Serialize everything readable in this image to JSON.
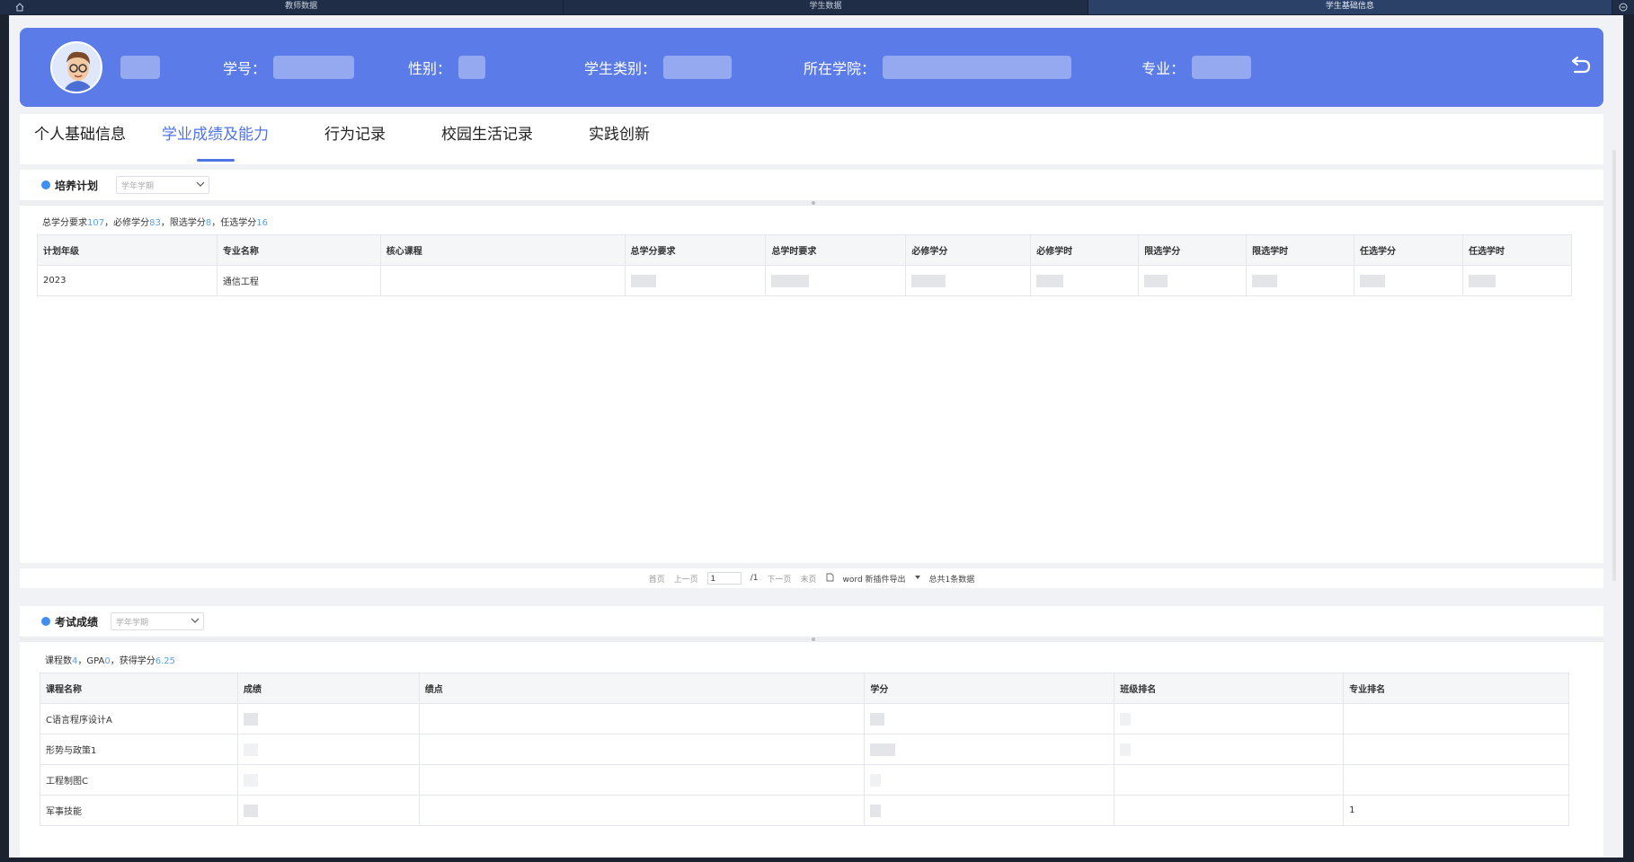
{
  "topbar": {
    "tabs": [
      "教师数据",
      "学生数据",
      "学生基础信息"
    ]
  },
  "profile": {
    "labels": {
      "student_no": "学号：",
      "gender": "性别：",
      "category": "学生类别：",
      "college": "所在学院：",
      "major": "专业："
    }
  },
  "nav": {
    "tabs": [
      "个人基础信息",
      "学业成绩及能力",
      "行为记录",
      "校园生活记录",
      "实践创新"
    ],
    "active_index": 1
  },
  "plan": {
    "title": "培养计划",
    "select_placeholder": "学年学期",
    "summary": {
      "total_label": "总学分要求",
      "total": "107",
      "req_label": "，必修学分",
      "req": "83",
      "lim_label": "，限选学分",
      "lim": "8",
      "opt_label": "，任选学分",
      "opt": "16"
    },
    "columns": [
      "计划年级",
      "专业名称",
      "核心课程",
      "总学分要求",
      "总学时要求",
      "必修学分",
      "必修学时",
      "限选学分",
      "限选学时",
      "任选学分",
      "任选学时"
    ],
    "rows": [
      {
        "year": "2023",
        "major": "通信工程"
      }
    ]
  },
  "pager": {
    "first": "首页",
    "prev": "上一页",
    "page": "1",
    "of": "/1",
    "next": "下一页",
    "last": "末页",
    "export": "word 新插件导出",
    "total": "总共1条数据"
  },
  "exam": {
    "title": "考试成绩",
    "select_placeholder": "学年学期",
    "summary": {
      "courses_label": "课程数",
      "courses": "4",
      "gpa_label": "，GPA",
      "gpa": "0",
      "credits_label": "，获得学分",
      "credits": "6.25"
    },
    "columns": [
      "课程名称",
      "成绩",
      "绩点",
      "学分",
      "班级排名",
      "专业排名"
    ],
    "rows": [
      {
        "course": "C语言程序设计A",
        "major_rank": ""
      },
      {
        "course": "形势与政策1",
        "major_rank": ""
      },
      {
        "course": "工程制图C",
        "major_rank": ""
      },
      {
        "course": "军事技能",
        "major_rank": "1"
      }
    ]
  }
}
